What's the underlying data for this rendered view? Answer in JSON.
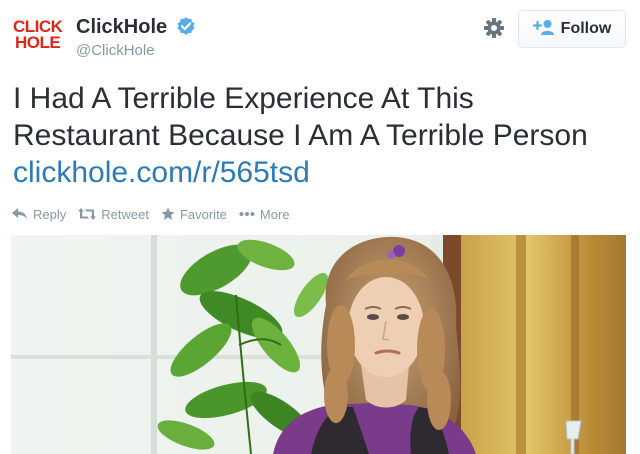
{
  "tweet": {
    "logo": {
      "line1": "CLICK",
      "line2": "HOLE"
    },
    "author": {
      "name": "ClickHole",
      "handle": "@ClickHole",
      "verified": true
    },
    "follow_label": "Follow",
    "text_lines": [
      "I Had A Terrible Experience At This",
      "Restaurant Because I Am A Terrible Person"
    ],
    "link": "clickhole.com/r/565tsd",
    "actions": {
      "reply": "Reply",
      "retweet": "Retweet",
      "favorite": "Favorite",
      "more": "More"
    }
  },
  "colors": {
    "brand_red": "#e0251b",
    "link_blue": "#2b7bb9",
    "verified_blue": "#55acee",
    "muted": "#8899a6",
    "text": "#292f33"
  }
}
